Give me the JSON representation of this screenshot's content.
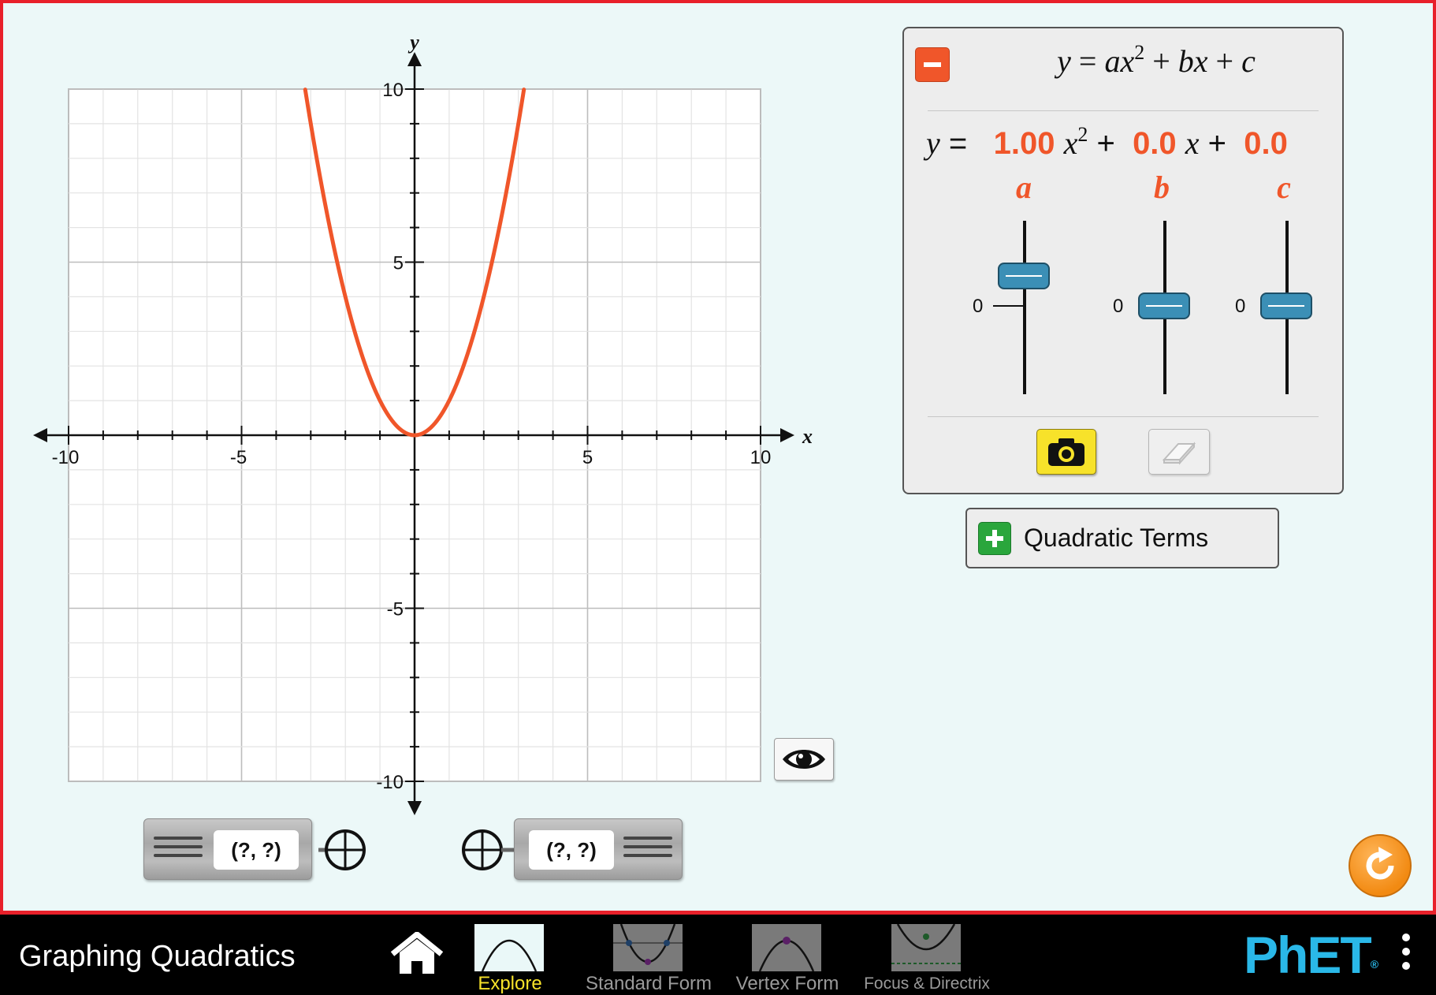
{
  "graph": {
    "x_axis": {
      "label": "x",
      "range": [
        -10,
        10
      ],
      "tick_labels": [
        "-10",
        "-5",
        "5",
        "10"
      ]
    },
    "y_axis": {
      "label": "y",
      "range": [
        -10,
        10
      ],
      "tick_labels": [
        "10",
        "5",
        "-5",
        "-10"
      ]
    },
    "grid": true,
    "curve": {
      "color": "#f0562a",
      "a": 1.0,
      "b": 0.0,
      "c": 0.0
    }
  },
  "point_tools": {
    "left": {
      "value": "(?, ?)"
    },
    "right": {
      "value": "(?, ?)"
    }
  },
  "equation_panel": {
    "general_form": {
      "y": "y",
      "eq": " = ",
      "ax2": "ax",
      "exp": "2",
      "plus1": " + ",
      "bx": "bx",
      "plus2": " + ",
      "c": "c"
    },
    "interactive": {
      "y": "y",
      "equals": " = ",
      "a_value": "1.00",
      "x_var": "x",
      "exponent": "2",
      "plus1": " + ",
      "b_value": "0.0",
      "x_var2": "x",
      "plus2": " + ",
      "c_value": "0.0"
    },
    "coefficients": [
      {
        "name": "a",
        "value": 1.0,
        "zero_label": "0"
      },
      {
        "name": "b",
        "value": 0.0,
        "zero_label": "0"
      },
      {
        "name": "c",
        "value": 0.0,
        "zero_label": "0"
      }
    ],
    "accent_color": "#f0562a",
    "save_icon": "camera-icon",
    "erase_icon": "eraser-icon"
  },
  "quadratic_terms": {
    "label": "Quadratic Terms",
    "icon": "plus-icon"
  },
  "nav": {
    "title": "Graphing Quadratics",
    "home_icon": "home-icon",
    "screens": [
      {
        "label": "Explore",
        "selected": true
      },
      {
        "label": "Standard Form",
        "selected": false
      },
      {
        "label": "Vertex Form",
        "selected": false
      },
      {
        "label": "Focus & Directrix",
        "selected": false
      }
    ],
    "logo": "PhET",
    "logo_reg": "®"
  }
}
